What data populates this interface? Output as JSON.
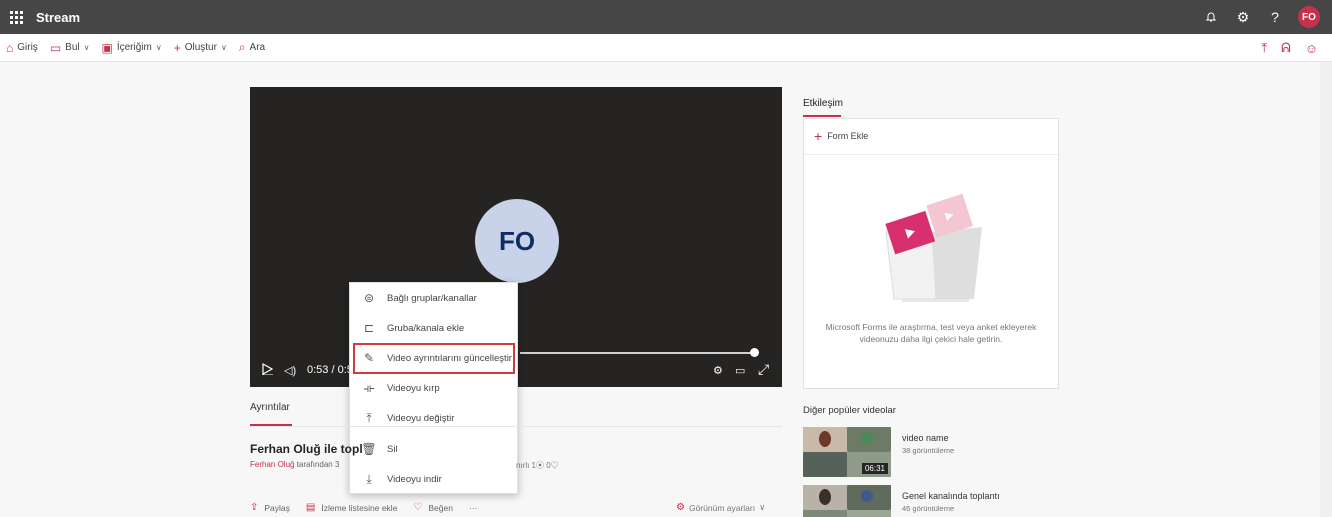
{
  "app": {
    "title": "Stream",
    "user_initials": "FO"
  },
  "nav": {
    "items": [
      {
        "label": "Giriş",
        "icon": "home-icon",
        "dropdown": false
      },
      {
        "label": "Bul",
        "icon": "discover-icon",
        "dropdown": true
      },
      {
        "label": "İçeriğim",
        "icon": "my-content-icon",
        "dropdown": true
      },
      {
        "label": "Oluştur",
        "icon": "plus-icon",
        "dropdown": true
      },
      {
        "label": "Ara",
        "icon": "search-icon",
        "dropdown": false
      }
    ]
  },
  "player": {
    "avatar_initials": "FO",
    "time_current": "0:53 / 0:5",
    "progress_fraction": 0.95
  },
  "context_menu": {
    "items": [
      {
        "label": "Bağlı gruplar/kanallar",
        "icon": "linked-groups-icon"
      },
      {
        "label": "Gruba/kanala ekle",
        "icon": "add-to-group-icon"
      },
      {
        "label": "Video ayrıntılarını güncelleştir",
        "icon": "pencil-icon",
        "highlighted": true
      },
      {
        "label": "Videoyu kırp",
        "icon": "trim-icon"
      },
      {
        "label": "Videoyu değiştir",
        "icon": "replace-icon"
      },
      {
        "label": "Sil",
        "icon": "trash-icon"
      },
      {
        "label": "Videoyu indir",
        "icon": "download-icon"
      }
    ]
  },
  "details": {
    "tab_label": "Ayrıntılar",
    "video_title": "Ferhan Oluğ ile topl",
    "owner": "Ferhan Oluğ",
    "byline_rest": " tarafından 3",
    "stats": "nırlı  1⦿  0♡",
    "actions": {
      "share": "Paylaş",
      "watchlist": "İzleme listesine ekle",
      "like": "Beğen",
      "more": "···"
    },
    "view_settings": "Görünüm ayarları"
  },
  "interaction": {
    "title": "Etkileşim",
    "add_form": "Form Ekle",
    "description": "Microsoft Forms ile araştırma, test veya anket ekleyerek videonuzu daha ilgi çekici hale getirin."
  },
  "other_videos": {
    "title": "Diğer popüler videolar",
    "items": [
      {
        "name": "video name",
        "views": "38 görüntüleme",
        "duration": "06:31"
      },
      {
        "name": "Genel kanalında toplantı",
        "views": "46 görüntüleme",
        "duration": ""
      }
    ]
  },
  "colors": {
    "accent": "#c4314b",
    "topbar": "#464646",
    "player_bg": "#252423",
    "menu_highlight": "#d43a3a"
  }
}
